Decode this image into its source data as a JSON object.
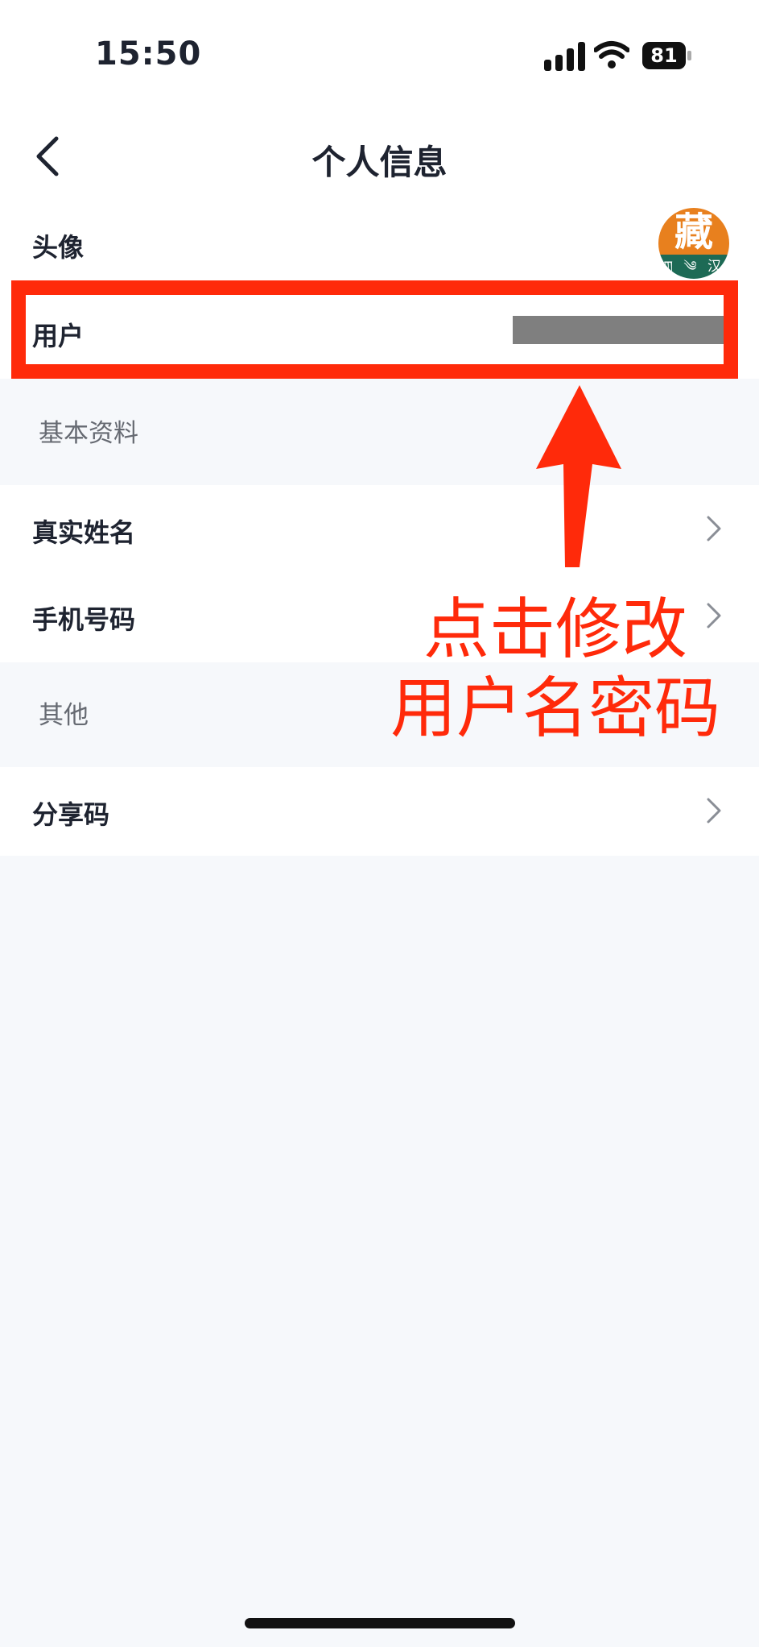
{
  "status_bar": {
    "time": "15:50",
    "battery_level": "81",
    "icons": [
      "cellular-signal-icon",
      "wifi-icon",
      "battery-icon"
    ]
  },
  "nav": {
    "title": "个人信息",
    "back_icon": "chevron-left-icon"
  },
  "rows": {
    "avatar": {
      "label": "头像",
      "image_char": "藏",
      "image_sub": "ཀ ༄ 汉"
    },
    "username": {
      "label": "用户"
    },
    "real_name": {
      "label": "真实姓名"
    },
    "phone": {
      "label": "手机号码"
    },
    "share_code": {
      "label": "分享码"
    }
  },
  "sections": {
    "basic": "基本资料",
    "other": "其他"
  },
  "annotation": {
    "line1": "点击修改",
    "line2": "用户名密码",
    "color": "#ff2a0a"
  },
  "colors": {
    "background": "#f6f8fb",
    "surface": "#ffffff",
    "text": "#1e2330",
    "secondary": "#666a72",
    "annotation": "#ff2a0a"
  }
}
